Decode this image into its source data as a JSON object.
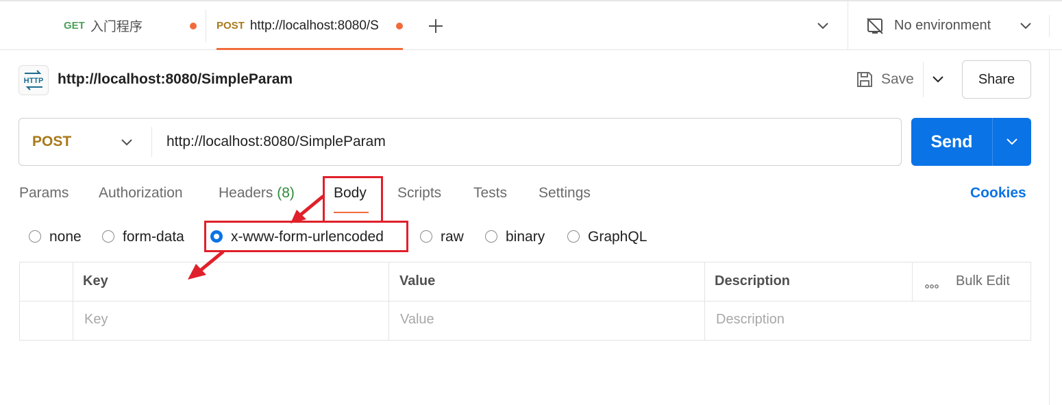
{
  "tabs": [
    {
      "method": "GET",
      "title": "入门程序",
      "method_color": "#4f9f5a"
    },
    {
      "method": "POST",
      "title": "http://localhost:8080/S",
      "method_color": "#a9781a"
    }
  ],
  "environment": {
    "label": "No environment"
  },
  "request": {
    "name": "http://localhost:8080/SimpleParam",
    "method": "POST",
    "url": "http://localhost:8080/SimpleParam"
  },
  "actions": {
    "save": "Save",
    "share": "Share",
    "send": "Send",
    "http_badge": "HTTP"
  },
  "request_tabs": {
    "params": "Params",
    "authorization": "Authorization",
    "headers": "Headers",
    "headers_count": "(8)",
    "body": "Body",
    "scripts": "Scripts",
    "tests": "Tests",
    "settings": "Settings",
    "cookies": "Cookies"
  },
  "body_types": [
    "none",
    "form-data",
    "x-www-form-urlencoded",
    "raw",
    "binary",
    "GraphQL"
  ],
  "selected_body_type": "x-www-form-urlencoded",
  "table": {
    "headers": {
      "key": "Key",
      "value": "Value",
      "description": "Description",
      "bulk_edit": "Bulk Edit"
    },
    "placeholders": {
      "key": "Key",
      "value": "Value",
      "description": "Description"
    }
  },
  "colors": {
    "accent": "#0a73e6",
    "post": "#a9781a",
    "get": "#4f9f5a",
    "unsaved_dot": "#f26b3a",
    "annotation": "#e0202a"
  }
}
